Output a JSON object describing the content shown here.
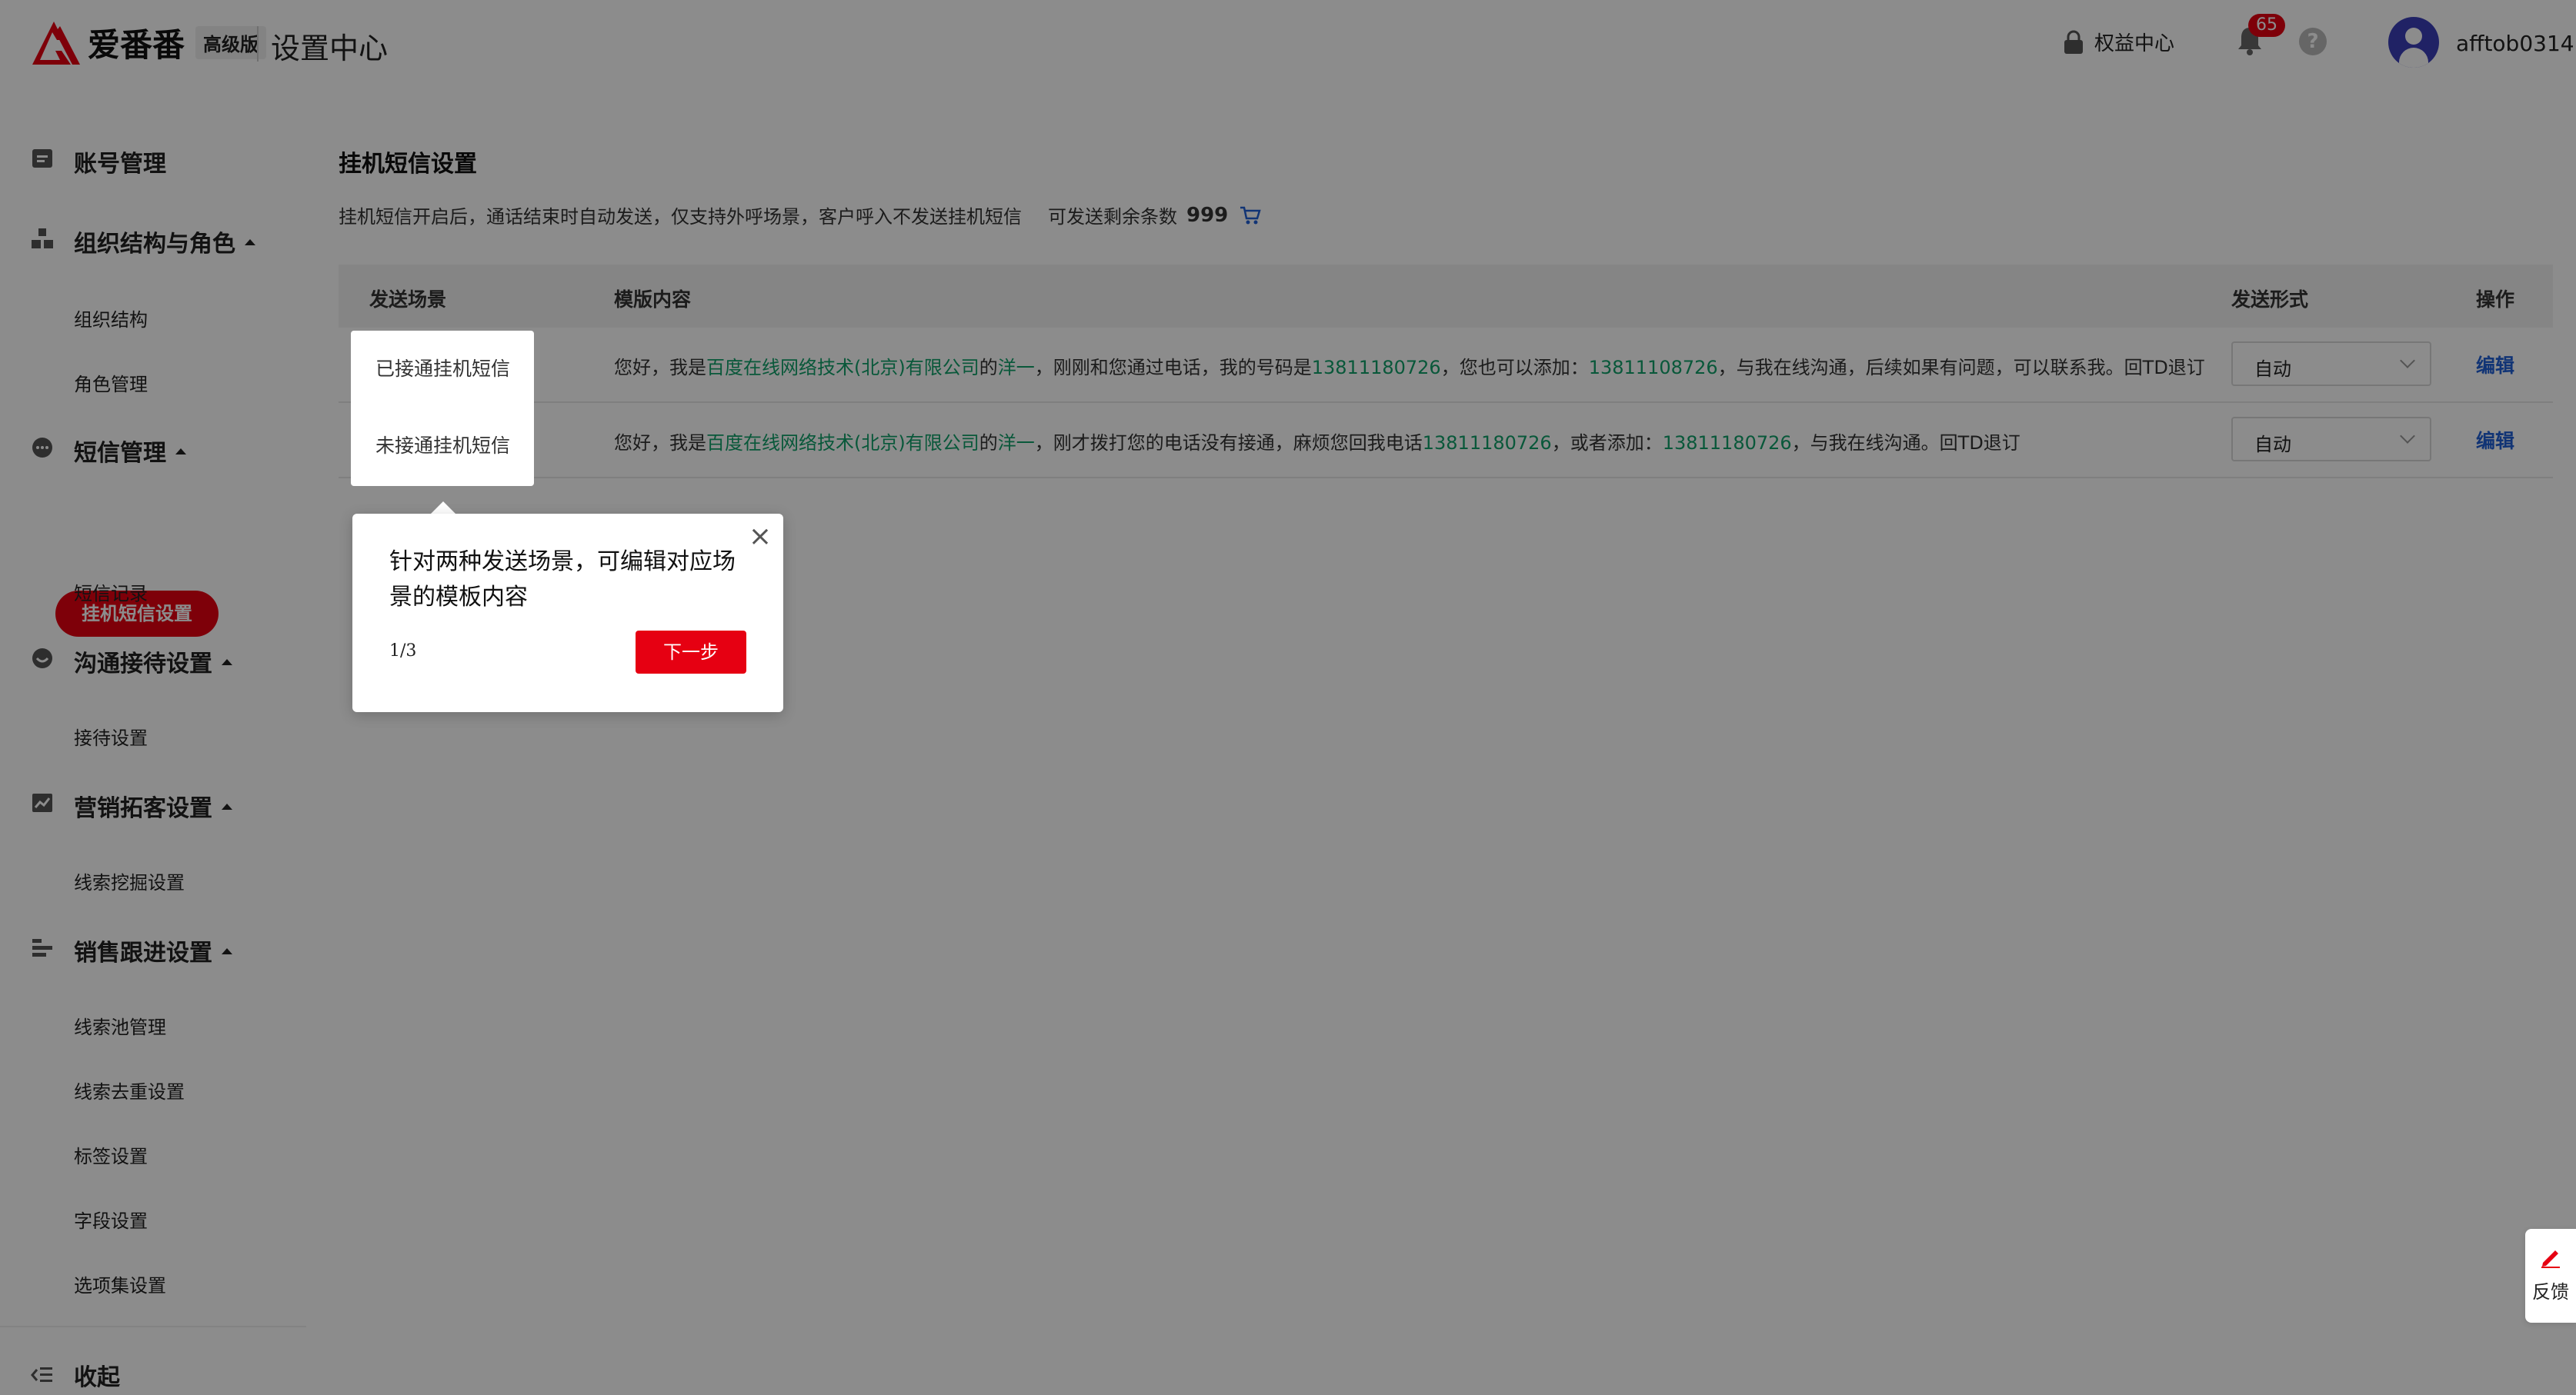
{
  "header": {
    "brand_name": "爱番番",
    "brand_badge": "高级版",
    "title": "设置中心",
    "rights_label": "权益中心",
    "notification_count": "65",
    "help_glyph": "?",
    "username": "afftob0314"
  },
  "sidebar": {
    "groups": [
      {
        "label": "账号管理",
        "icon": "account-icon"
      },
      {
        "label": "组织结构与角色",
        "icon": "org-icon"
      },
      {
        "label": "短信管理",
        "icon": "sms-icon"
      },
      {
        "label": "沟通接待设置",
        "icon": "chat-icon"
      },
      {
        "label": "营销拓客设置",
        "icon": "marketing-icon"
      },
      {
        "label": "销售跟进设置",
        "icon": "sales-icon"
      }
    ],
    "items": {
      "org_structure": "组织结构",
      "role_mgmt": "角色管理",
      "hangup_sms": "挂机短信设置",
      "sms_records": "短信记录",
      "reception": "接待设置",
      "lead_mining": "线索挖掘设置",
      "lead_pool": "线索池管理",
      "lead_dedup": "线索去重设置",
      "tag_settings": "标签设置",
      "field_settings": "字段设置",
      "option_set": "选项集设置"
    },
    "collapse_label": "收起"
  },
  "main": {
    "title": "挂机短信设置",
    "description": "挂机短信开启后，通话结束时自动发送，仅支持外呼场景，客户呼入不发送挂机短信",
    "remain_label": "可发送剩余条数",
    "remain_count": "999",
    "table": {
      "headers": {
        "scene": "发送场景",
        "template": "模版内容",
        "mode": "发送形式",
        "action": "操作"
      },
      "rows": [
        {
          "scene": "已接通挂机短信",
          "tpl": {
            "p1": "您好，我是",
            "company": "百度在线网络技术(北京)有限公司",
            "p2": "的",
            "person": "洋一",
            "p3": "，刚刚和您通过电话，我的号码是",
            "phone1": "13811180726",
            "p4": "，您也可以添加：",
            "phone2": "13811108726",
            "p5": "，与我在线沟通，后续如果有问题，可以联系我。回TD退订"
          },
          "mode": "自动",
          "action": "编辑"
        },
        {
          "scene": "未接通挂机短信",
          "tpl": {
            "p1": "您好，我是",
            "company": "百度在线网络技术(北京)有限公司",
            "p2": "的",
            "person": "洋一",
            "p3": "，刚才拨打您的电话没有接通，麻烦您回我电话",
            "phone1": "13811180726",
            "p4": "，或者添加：",
            "phone2": "13811180726",
            "p5": "，与我在线沟通。回TD退订"
          },
          "mode": "自动",
          "action": "编辑"
        }
      ]
    }
  },
  "guide": {
    "text": "针对两种发送场景，可编辑对应场景的模板内容",
    "step": "1/3",
    "next_label": "下一步",
    "close_glyph": "×"
  },
  "feedback": {
    "label": "反馈"
  },
  "colors": {
    "brand_red": "#e60012",
    "link_blue": "#1f5fd6",
    "highlight_green": "#11a06a"
  }
}
